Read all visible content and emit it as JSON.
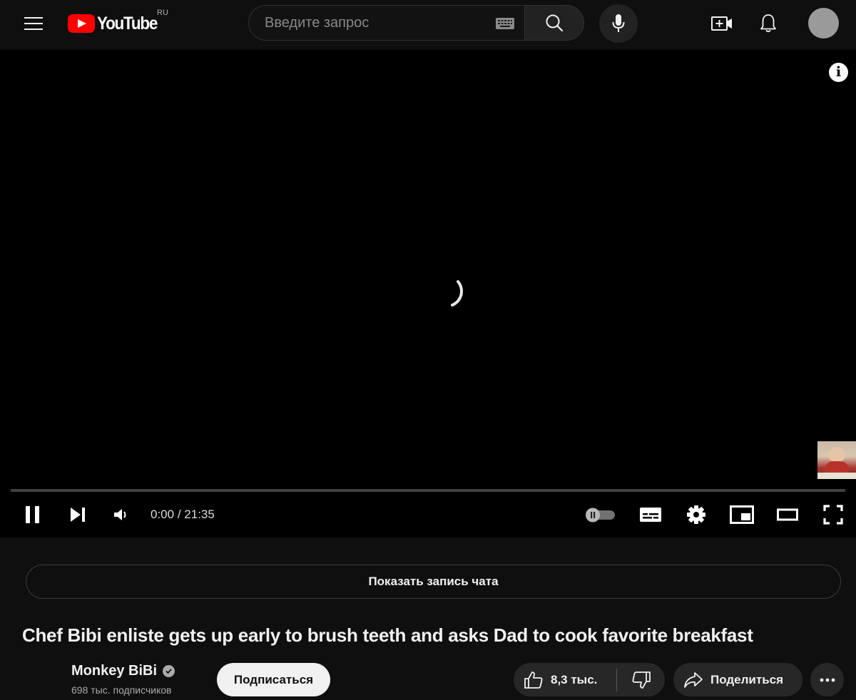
{
  "header": {
    "logo_text": "YouTube",
    "region": "RU",
    "search_placeholder": "Введите запрос",
    "icons": [
      "menu-icon",
      "keyboard-icon",
      "search-icon",
      "mic-icon",
      "create-video-icon",
      "bell-icon",
      "avatar"
    ]
  },
  "player": {
    "time_current": "0:00",
    "time_separator": "/",
    "time_total": "21:35",
    "progress_fraction": 0.0,
    "state": "loading",
    "info_label": "i",
    "progress_color": "#ff0000"
  },
  "chat": {
    "show_replay_label": "Показать запись чата"
  },
  "video": {
    "title": "Chef Bibi enliste gets up early to brush teeth and asks Dad to cook favorite breakfast",
    "channel": {
      "name": "Monkey BiBi",
      "verified": true,
      "subscribers": "698 тыс. подписчиков"
    },
    "subscribe_label": "Подписаться",
    "likes": "8,3 тыс.",
    "share_label": "Поделиться"
  },
  "colors": {
    "background": "#0f0f0f",
    "player_background": "#000000",
    "button_background": "#272727",
    "subscribe_background": "#f1f1f1",
    "logo_red": "#ff0000"
  }
}
